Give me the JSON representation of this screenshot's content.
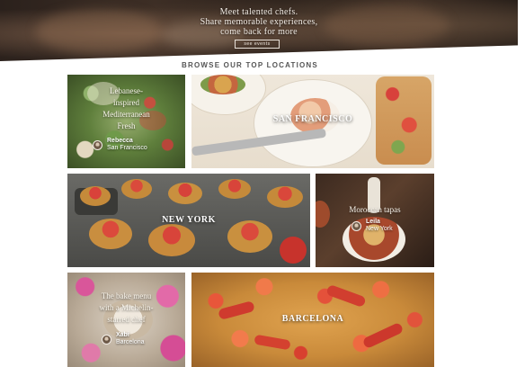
{
  "hero": {
    "line1": "Meet talented chefs.",
    "line2": "Share memorable experiences,",
    "line3": "come back for more",
    "button_label": "see events"
  },
  "section": {
    "title": "BROWSE OUR TOP LOCATIONS"
  },
  "tiles": {
    "lebanese": {
      "quote": [
        "Lebanese-",
        "inspired",
        "Mediterranean",
        "Fresh"
      ],
      "chef_name": "Rebecca",
      "chef_city": "San Francisco"
    },
    "san_francisco": {
      "title": "SAN FRANCISCO"
    },
    "new_york": {
      "title": "NEW YORK"
    },
    "moroccan": {
      "quote": [
        "Moroccan tapas"
      ],
      "chef_name": "Leila",
      "chef_city": "New York"
    },
    "michelin": {
      "quote": [
        "The bake menu",
        "with a Michelin-",
        "starred chef"
      ],
      "chef_name": "Xabi",
      "chef_city": "Barcelona"
    },
    "barcelona": {
      "title": "BARCELONA"
    }
  },
  "colors": {
    "hero_dark": "#2b211c",
    "section_text": "#555555",
    "tile_text": "#ffffff"
  }
}
